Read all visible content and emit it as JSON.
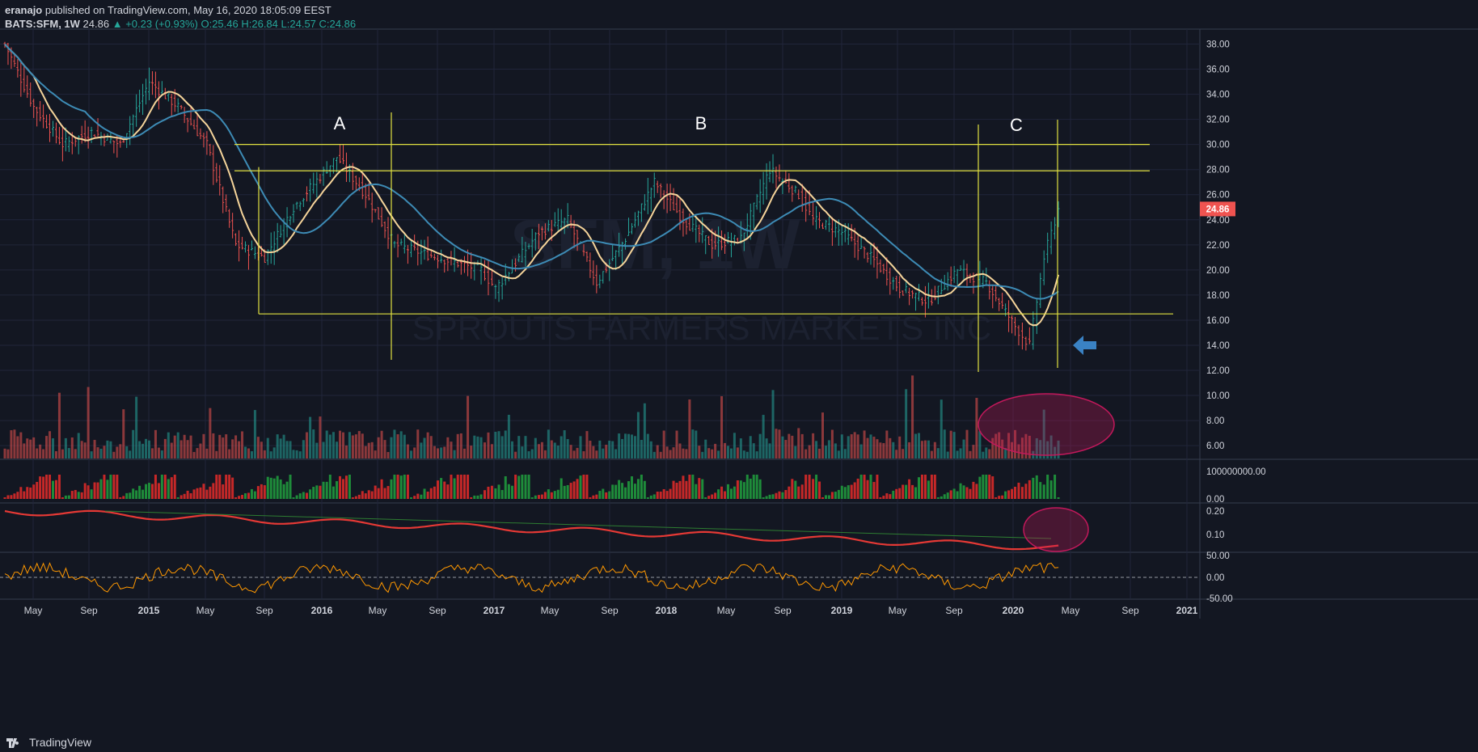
{
  "header": {
    "author": "eranajo",
    "published_text": "published on TradingView.com, May 16, 2020 18:05:09 EEST",
    "symbol": "BATS:SFM, 1W",
    "last": "24.86",
    "change": "+0.23 (+0.93%)",
    "open": "O:25.46",
    "high": "H:26.84",
    "low": "L:24.57",
    "close": "C:24.86"
  },
  "watermark": {
    "ticker": "SFM, 1W",
    "name": "SPROUTS FARMERS MARKETS INC"
  },
  "footer": {
    "brand": "TradingView"
  },
  "colors": {
    "background": "#131722",
    "grid": "#262b3e",
    "up": "#26a69a",
    "down": "#ef5350",
    "ma_fast": "#f5d49a",
    "ma_slow": "#3d8bb5",
    "annotation": "#e0e040",
    "price_badge": "#ef5350",
    "arrow": "#3a82c4",
    "ellipse": "#c2185b"
  },
  "chart_data": [
    {
      "type": "candlestick",
      "interval": "1W",
      "x_axis_labels": [
        "May",
        "Sep",
        "2015",
        "May",
        "Sep",
        "2016",
        "May",
        "Sep",
        "2017",
        "May",
        "Sep",
        "2018",
        "May",
        "Sep",
        "2019",
        "May",
        "Sep",
        "2020",
        "May",
        "Sep",
        "2021"
      ],
      "y_axis_labels": [
        "38.00",
        "36.00",
        "34.00",
        "32.00",
        "30.00",
        "28.00",
        "26.00",
        "24.00",
        "22.00",
        "20.00",
        "18.00",
        "16.00",
        "14.00",
        "12.00",
        "10.00",
        "8.00",
        "6.00"
      ],
      "ylim": [
        5,
        39
      ],
      "last_price_label": "24.86",
      "approx_close_path": [
        {
          "date": "2014-04",
          "close": 38.0
        },
        {
          "date": "2014-06",
          "close": 33.0
        },
        {
          "date": "2014-08",
          "close": 30.0
        },
        {
          "date": "2014-10",
          "close": 31.0
        },
        {
          "date": "2014-12",
          "close": 30.0
        },
        {
          "date": "2015-02",
          "close": 35.0
        },
        {
          "date": "2015-04",
          "close": 33.0
        },
        {
          "date": "2015-06",
          "close": 30.0
        },
        {
          "date": "2015-08",
          "close": 22.0
        },
        {
          "date": "2015-10",
          "close": 21.0
        },
        {
          "date": "2015-12",
          "close": 25.0
        },
        {
          "date": "2016-03",
          "close": 29.0
        },
        {
          "date": "2016-05",
          "close": 26.0
        },
        {
          "date": "2016-07",
          "close": 22.0
        },
        {
          "date": "2016-10",
          "close": 21.0
        },
        {
          "date": "2017-01",
          "close": 20.0
        },
        {
          "date": "2017-02",
          "close": 18.5
        },
        {
          "date": "2017-05",
          "close": 23.0
        },
        {
          "date": "2017-07",
          "close": 24.0
        },
        {
          "date": "2017-09",
          "close": 19.0
        },
        {
          "date": "2017-11",
          "close": 22.5
        },
        {
          "date": "2018-01",
          "close": 27.0
        },
        {
          "date": "2018-03",
          "close": 24.0
        },
        {
          "date": "2018-05",
          "close": 22.0
        },
        {
          "date": "2018-07",
          "close": 22.5
        },
        {
          "date": "2018-09",
          "close": 28.0
        },
        {
          "date": "2018-11",
          "close": 26.0
        },
        {
          "date": "2018-12",
          "close": 24.0
        },
        {
          "date": "2019-02",
          "close": 23.0
        },
        {
          "date": "2019-04",
          "close": 21.0
        },
        {
          "date": "2019-06",
          "close": 18.5
        },
        {
          "date": "2019-08",
          "close": 17.5
        },
        {
          "date": "2019-10",
          "close": 20.0
        },
        {
          "date": "2019-12",
          "close": 19.0
        },
        {
          "date": "2020-02",
          "close": 15.5
        },
        {
          "date": "2020-03",
          "close": 14.0
        },
        {
          "date": "2020-04",
          "close": 21.0
        },
        {
          "date": "2020-05",
          "close": 24.86
        }
      ],
      "annotations": {
        "labels": [
          "A",
          "B",
          "C"
        ],
        "horizontal_levels": [
          30.0,
          27.9,
          16.5
        ],
        "arrow_at_price": 14.0
      }
    },
    {
      "type": "bar",
      "name": "volume",
      "y_axis_labels": [
        "10.00",
        "8.00",
        "6.00"
      ]
    },
    {
      "type": "bar",
      "y_axis_labels": [
        "100000000.00",
        "0.00"
      ]
    },
    {
      "type": "line",
      "y_axis_labels": [
        "0.20",
        "0.10"
      ]
    },
    {
      "type": "line",
      "y_axis_labels": [
        "50.00",
        "0.00",
        "-50.00"
      ]
    }
  ]
}
